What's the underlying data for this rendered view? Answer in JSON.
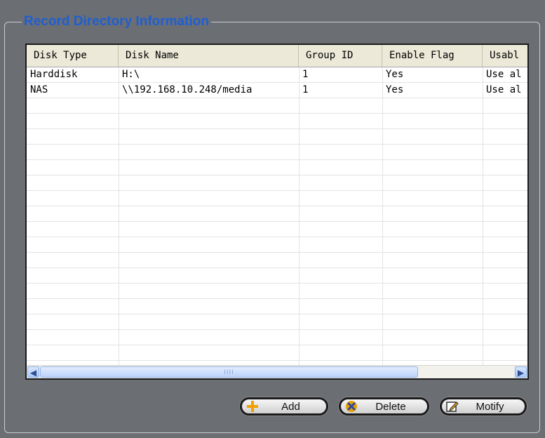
{
  "groupbox": {
    "title": "Record Directory Information"
  },
  "table": {
    "columns": [
      "Disk Type",
      "Disk Name",
      "Group ID",
      "Enable Flag",
      "Usabl"
    ],
    "rows": [
      [
        "Harddisk",
        "H:\\",
        "1",
        "Yes",
        "Use al"
      ],
      [
        "NAS",
        "\\\\192.168.10.248/media",
        "1",
        "Yes",
        "Use al"
      ]
    ],
    "scroll_left_glyph": "◀",
    "scroll_right_glyph": "▶",
    "scroll_grip_glyph": "IIII"
  },
  "buttons": {
    "add": "Add",
    "delete": "Delete",
    "modify": "Motify"
  },
  "icons": {
    "add": "plus-icon",
    "delete": "x-icon",
    "modify": "edit-icon"
  },
  "colors": {
    "title": "#1f5fd1",
    "background": "#6b6e73",
    "plus": "#f0a000",
    "x": "#e8a000"
  }
}
